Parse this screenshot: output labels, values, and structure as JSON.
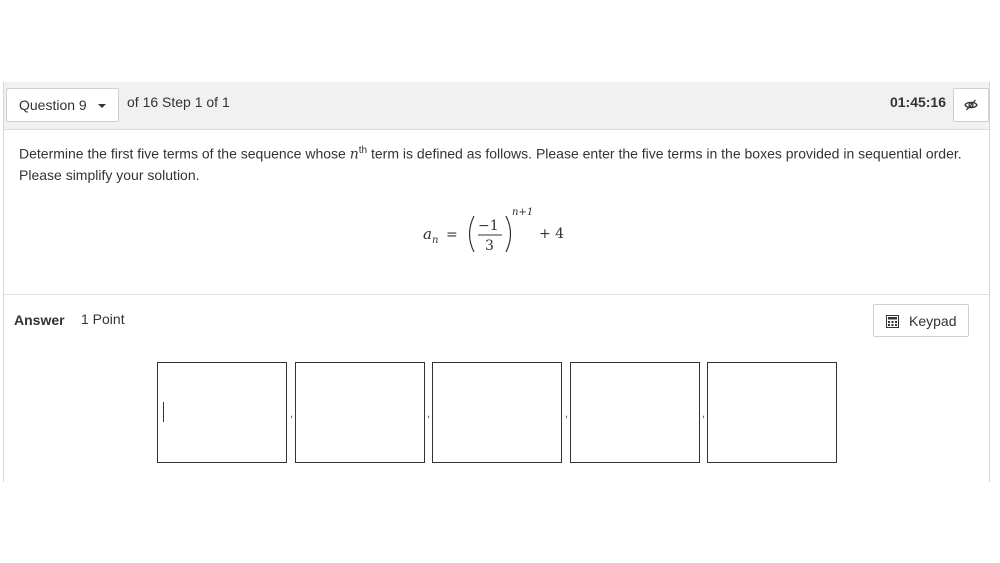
{
  "header": {
    "question_label": "Question 9",
    "step_text": "of 16 Step 1 of 1",
    "timer": "01:45:16",
    "visibility_icon": "eye-slash-icon"
  },
  "question": {
    "prompt_part1": "Determine the first five terms of the sequence whose ",
    "prompt_var": "n",
    "prompt_sup": "th",
    "prompt_part2": " term is defined as follows. Please enter the five terms in the boxes provided in sequential order. Please simplify your solution.",
    "formula": {
      "lhs_var": "a",
      "lhs_sub": "n",
      "equals": "=",
      "numerator": "−1",
      "denominator": "3",
      "exponent": "n+1",
      "tail": "+ 4"
    }
  },
  "answer": {
    "label": "Answer",
    "points": "1 Point",
    "keypad_label": "Keypad",
    "keypad_icon": "calculator-icon",
    "inputs": [
      "",
      "",
      "",
      "",
      ""
    ],
    "separator": ","
  }
}
